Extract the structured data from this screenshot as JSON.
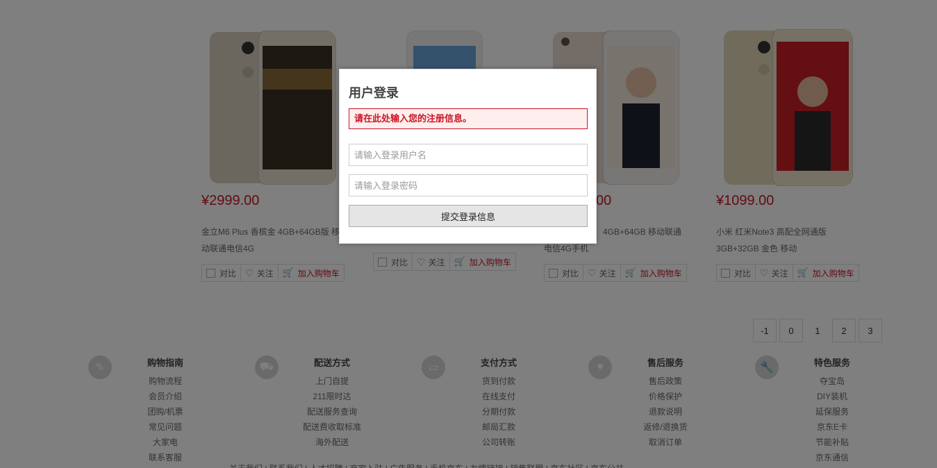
{
  "products": [
    {
      "price": "¥2999.00",
      "name_line1": "金立M6 Plus 香槟金 4GB+64GB版 移",
      "name_line2": "动联通电信4G"
    },
    {
      "price": "",
      "name_line1": "",
      "name_line2": ""
    },
    {
      "price": "00",
      "name_line1": "4GB+64GB 移动联通",
      "name_line2": "电信4G手机"
    },
    {
      "price": "¥1099.00",
      "name_line1": "小米 红米Note3 高配全网通版",
      "name_line2": "3GB+32GB 金色 移动"
    }
  ],
  "actions": {
    "compare": "对比",
    "follow": "关注",
    "add_cart": "加入购物车"
  },
  "pagination": [
    "-1",
    "0",
    "1",
    "2",
    "3"
  ],
  "footer": [
    {
      "icon": "pen-icon",
      "title": "购物指南",
      "items": [
        "购物流程",
        "会员介绍",
        "团购/机票",
        "常见问题",
        "大家电",
        "联系客服"
      ]
    },
    {
      "icon": "truck-icon",
      "title": "配送方式",
      "items": [
        "上门自提",
        "211限时达",
        "配送服务查询",
        "配送费收取标准",
        "海外配送"
      ]
    },
    {
      "icon": "wallet-icon",
      "title": "支付方式",
      "items": [
        "货到付款",
        "在线支付",
        "分期付款",
        "邮局汇款",
        "公司转账"
      ]
    },
    {
      "icon": "heart-icon",
      "title": "售后服务",
      "items": [
        "售后政策",
        "价格保护",
        "退款说明",
        "返修/退换货",
        "取消订单"
      ]
    },
    {
      "icon": "wrench-icon",
      "title": "特色服务",
      "items": [
        "夺宝岛",
        "DIY装机",
        "延保服务",
        "京东E卡",
        "节能补贴",
        "京东通信"
      ]
    }
  ],
  "bottom_links": "关于我们 | 联系我们 | 人才招聘 | 商家入驻 | 广告服务 | 手机京东 | 友情链接 | 销售联盟 | 京东社区 | 京东公益",
  "modal": {
    "title": "用户登录",
    "alert": "请在此处输入您的注册信息。",
    "username_placeholder": "请输入登录用户名",
    "password_placeholder": "请输入登录密码",
    "submit_label": "提交登录信息"
  }
}
